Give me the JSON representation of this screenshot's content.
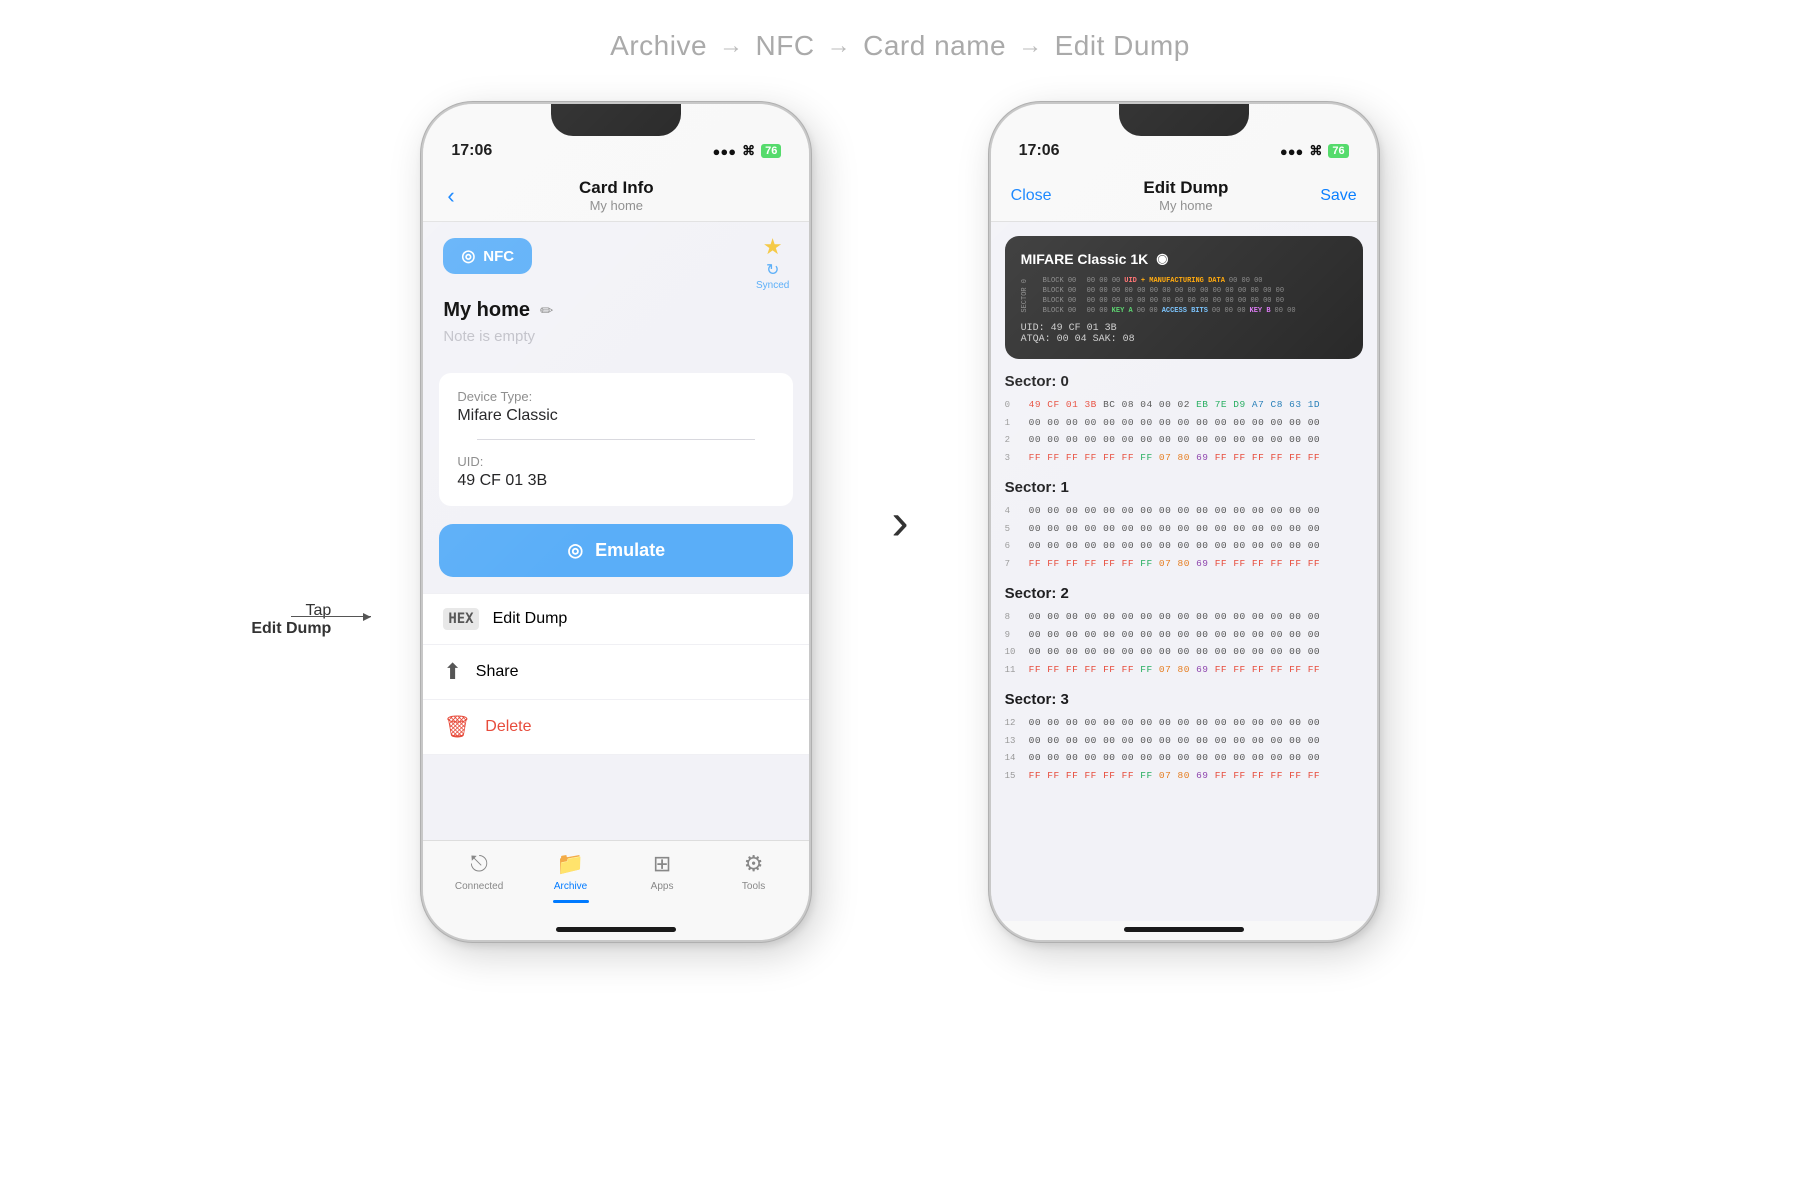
{
  "breadcrumb": {
    "items": [
      "Archive",
      "NFC",
      "Card name",
      "Edit Dump"
    ],
    "arrows": [
      "→",
      "→",
      "→"
    ]
  },
  "phone1": {
    "status_bar": {
      "time": "17:06",
      "signal": "●●●",
      "wifi": "WiFi",
      "battery": "76"
    },
    "nav": {
      "back_icon": "‹",
      "title": "Card Info",
      "subtitle": "My home"
    },
    "nfc_tag": "NFC",
    "synced_label": "Synced",
    "card_name": "My home",
    "note_placeholder": "Note is empty",
    "device_type_label": "Device Type:",
    "device_type_value": "Mifare Classic",
    "uid_label": "UID:",
    "uid_value": "49 CF 01 3B",
    "emulate_label": "Emulate",
    "actions": [
      {
        "icon": "HEX",
        "label": "Edit Dump"
      },
      {
        "icon": "↑",
        "label": "Share"
      },
      {
        "icon": "🗑",
        "label": "Delete",
        "type": "delete"
      }
    ],
    "tabs": [
      {
        "icon": "⎋",
        "label": "Connected",
        "active": false
      },
      {
        "icon": "📁",
        "label": "Archive",
        "active": true
      },
      {
        "icon": "⊞",
        "label": "Apps",
        "active": false
      },
      {
        "icon": "⚙",
        "label": "Tools",
        "active": false
      }
    ],
    "annotation": {
      "tap_label": "Tap",
      "edit_label": "Edit Dump"
    }
  },
  "phone2": {
    "status_bar": {
      "time": "17:06",
      "signal": "●●●",
      "battery": "76"
    },
    "nav": {
      "close_label": "Close",
      "title": "Edit Dump",
      "subtitle": "My home",
      "save_label": "Save"
    },
    "mifare_card": {
      "title": "MIFARE Classic 1K",
      "sector0_rows": [
        {
          "label": "BLOCK 00",
          "data": "00 00 00",
          "uid": "UID",
          "mfg": "+ MANUFACTURING DATA",
          "end": "00 00 00"
        },
        {
          "label": "BLOCK 00",
          "data": "00 00 00 00 00 00 00 00 00 00 00 00 00 00 00 00"
        },
        {
          "label": "BLOCK 00",
          "data": "00 00 00 00 00 00 00 00 00 00 00 00 00 00 00 00"
        },
        {
          "label": "BLOCK 00",
          "keyA": "KEY A",
          "mid": "00 00 00",
          "access": "ACCESS BITS",
          "end": "00 00 00",
          "keyB": "KEY B",
          "keyBval": "00 00"
        }
      ],
      "uid_line": "UID:  49 CF 01 3B",
      "atqa_line": "ATQA:  00 04    SAK:  08"
    },
    "sectors": [
      {
        "title": "Sector: 0",
        "rows": [
          {
            "num": "0",
            "data": "49 CF 01 3B BC 08 04 00 02 EB 7E D9 A7 C8 63 1D",
            "color": "multi0"
          },
          {
            "num": "1",
            "data": "00 00 00 00 00 00 00 00 00 00 00 00 00 00 00 00",
            "color": "normal"
          },
          {
            "num": "2",
            "data": "00 00 00 00 00 00 00 00 00 00 00 00 00 00 00 00",
            "color": "normal"
          },
          {
            "num": "3",
            "data": "FF FF FF FF FF FF FF 07 80 69 FF FF FF FF FF FF",
            "color": "trailer"
          }
        ]
      },
      {
        "title": "Sector: 1",
        "rows": [
          {
            "num": "4",
            "data": "00 00 00 00 00 00 00 00 00 00 00 00 00 00 00 00",
            "color": "normal"
          },
          {
            "num": "5",
            "data": "00 00 00 00 00 00 00 00 00 00 00 00 00 00 00 00",
            "color": "normal"
          },
          {
            "num": "6",
            "data": "00 00 00 00 00 00 00 00 00 00 00 00 00 00 00 00",
            "color": "normal"
          },
          {
            "num": "7",
            "data": "FF FF FF FF FF FF FF 07 80 69 FF FF FF FF FF FF",
            "color": "trailer"
          }
        ]
      },
      {
        "title": "Sector: 2",
        "rows": [
          {
            "num": "8",
            "data": "00 00 00 00 00 00 00 00 00 00 00 00 00 00 00 00",
            "color": "normal"
          },
          {
            "num": "9",
            "data": "00 00 00 00 00 00 00 00 00 00 00 00 00 00 00 00",
            "color": "normal"
          },
          {
            "num": "10",
            "data": "00 00 00 00 00 00 00 00 00 00 00 00 00 00 00 00",
            "color": "normal"
          },
          {
            "num": "11",
            "data": "FF FF FF FF FF FF FF 07 80 69 FF FF FF FF FF FF",
            "color": "trailer"
          }
        ]
      },
      {
        "title": "Sector: 3",
        "rows": [
          {
            "num": "12",
            "data": "00 00 00 00 00 00 00 00 00 00 00 00 00 00 00 00",
            "color": "normal"
          },
          {
            "num": "13",
            "data": "00 00 00 00 00 00 00 00 00 00 00 00 00 00 00 00",
            "color": "normal"
          },
          {
            "num": "14",
            "data": "00 00 00 00 00 00 00 00 00 00 00 00 00 00 00 00",
            "color": "normal"
          },
          {
            "num": "15",
            "data": "FF FF FF FF FF FF FF 07 80 69 FF FF FF FF FF FF",
            "color": "trailer"
          }
        ]
      }
    ]
  },
  "arrow_between": "›"
}
